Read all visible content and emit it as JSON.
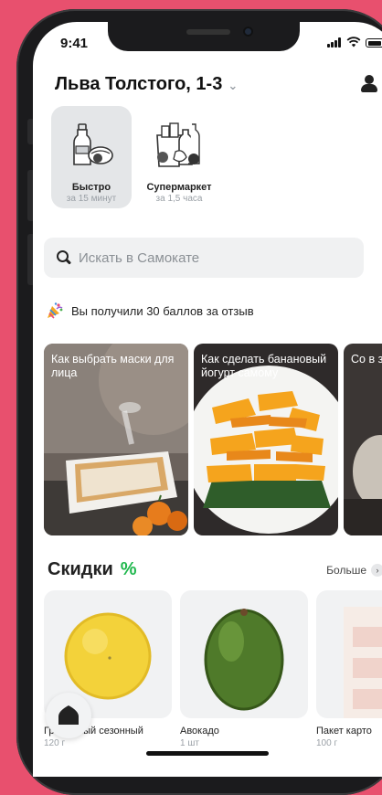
{
  "status": {
    "time": "9:41"
  },
  "header": {
    "address": "Льва Толстого, 1-3"
  },
  "modes": [
    {
      "title": "Быстро",
      "subtitle": "за 15 минут",
      "active": true
    },
    {
      "title": "Супермаркет",
      "subtitle": "за 1,5 часа",
      "active": false
    }
  ],
  "search": {
    "placeholder": "Искать в Самокате"
  },
  "bonus": {
    "text": "Вы получили 30 баллов за отзыв"
  },
  "stories": [
    {
      "title": "Как выбрать маски для лица"
    },
    {
      "title": "Как сделать банановый йогурт самому"
    },
    {
      "title": "Со в загр"
    }
  ],
  "discounts": {
    "title": "Скидки",
    "badge": "%",
    "more_label": "Больше",
    "more_icon": "chevron-right-icon"
  },
  "products": [
    {
      "name": "Гр   красный сезонный",
      "qty": "120 г"
    },
    {
      "name": "Авокадо",
      "qty": "1 шт"
    },
    {
      "name": "Пакет карто",
      "qty": "100 г"
    }
  ],
  "colors": {
    "accent_green": "#1fb74d",
    "background_pink": "#e8506e"
  }
}
